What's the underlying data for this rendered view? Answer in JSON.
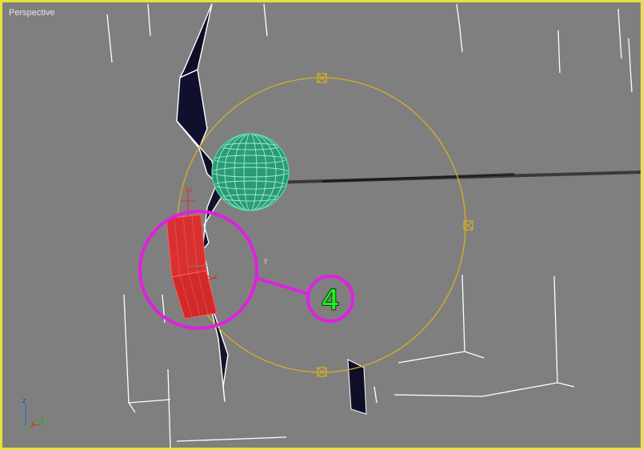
{
  "viewport": {
    "label": "Perspective",
    "border_color": "#e8e040",
    "background_color": "#7f7f7f"
  },
  "scene": {
    "callout": {
      "number": "4",
      "color": "#e020e0",
      "text_color": "#22ee22"
    },
    "gizmo_axes": {
      "x": "x",
      "y": "y",
      "z": "z"
    },
    "world_axes": {
      "x": "x",
      "y": "y",
      "z": "z"
    },
    "colors": {
      "grid_lines": "#ffffff",
      "selection_circle": "#d8b020",
      "sphere": "#2fd49a",
      "plane": "#d83030",
      "blade": "#101028"
    }
  }
}
